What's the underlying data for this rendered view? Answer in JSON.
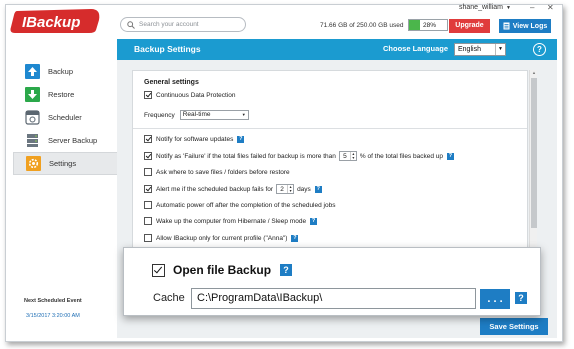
{
  "app": {
    "logo_text": "IBackup"
  },
  "search": {
    "placeholder": "Search your account"
  },
  "user": {
    "name": "shane_william"
  },
  "storage": {
    "usage_text": "71.66 GB of 250.00 GB used",
    "percent_text": "28%",
    "percent": 28
  },
  "header": {
    "upgrade_label": "Upgrade",
    "view_logs_label": "View Logs"
  },
  "titlebar": {
    "title": "Backup Settings",
    "language_label": "Choose Language",
    "language_value": "English",
    "help": "?"
  },
  "sidebar": {
    "items": [
      {
        "label": "Backup",
        "icon": "upload-arrow-icon"
      },
      {
        "label": "Restore",
        "icon": "download-arrow-icon"
      },
      {
        "label": "Scheduler",
        "icon": "calendar-icon"
      },
      {
        "label": "Server Backup",
        "icon": "server-icon"
      },
      {
        "label": "Settings",
        "icon": "gear-icon"
      }
    ],
    "next_event_label": "Next Scheduled Event",
    "next_event_value": "3/15/2017 3:20:00 AM"
  },
  "settings": {
    "general_title": "General settings",
    "cdp_label": "Continuous Data Protection",
    "frequency_label": "Frequency",
    "frequency_value": "Real-time",
    "notify_updates": "Notify for software updates",
    "notify_failure_prefix": "Notify as 'Failure' if the total files failed for backup is more than",
    "notify_failure_value": "5",
    "notify_failure_suffix": "% of the total files backed up",
    "ask_restore": "Ask where to save files / folders before restore",
    "alert_prefix": "Alert me if the scheduled backup fails for",
    "alert_value": "2",
    "alert_suffix": "days",
    "auto_power_off": "Automatic power off after the completion of the scheduled jobs",
    "wake_up": "Wake up the computer from Hibernate / Sleep mode",
    "allow_profile": "Allow IBackup only for current profile (\"Anna\")"
  },
  "callout": {
    "open_file_label": "Open file Backup",
    "cache_label": "Cache",
    "cache_value": "C:\\ProgramData\\IBackup\\",
    "browse_label": ". . ."
  },
  "footer": {
    "save_label": "Save Settings"
  },
  "colors": {
    "accent": "#1b9bd0",
    "button_blue": "#1e7dc4",
    "upgrade_red": "#e03b3b",
    "quota_green": "#4bb64b"
  }
}
